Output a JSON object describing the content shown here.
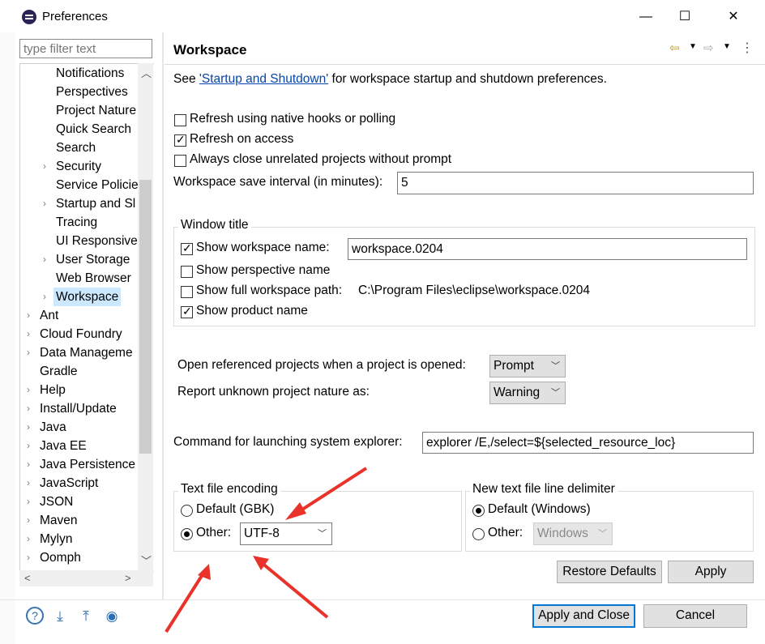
{
  "window": {
    "title": "Preferences",
    "minimize": "—",
    "maximize": "☐",
    "close": "✕"
  },
  "filter": {
    "placeholder": "type filter text"
  },
  "tree": {
    "items": [
      {
        "label": "Notifications",
        "expandable": false
      },
      {
        "label": "Perspectives",
        "expandable": false
      },
      {
        "label": "Project Nature",
        "expandable": false
      },
      {
        "label": "Quick Search",
        "expandable": false
      },
      {
        "label": "Search",
        "expandable": false
      },
      {
        "label": "Security",
        "expandable": true
      },
      {
        "label": "Service Policie",
        "expandable": false
      },
      {
        "label": "Startup and Sl",
        "expandable": true
      },
      {
        "label": "Tracing",
        "expandable": false
      },
      {
        "label": "UI Responsive",
        "expandable": false
      },
      {
        "label": "User Storage",
        "expandable": true
      },
      {
        "label": "Web Browser",
        "expandable": false
      },
      {
        "label": "Workspace",
        "expandable": true,
        "selected": true
      },
      {
        "label": "Ant",
        "expandable": true
      },
      {
        "label": "Cloud Foundry",
        "expandable": true
      },
      {
        "label": "Data Manageme",
        "expandable": true
      },
      {
        "label": "Gradle",
        "expandable": false
      },
      {
        "label": "Help",
        "expandable": true
      },
      {
        "label": "Install/Update",
        "expandable": true
      },
      {
        "label": "Java",
        "expandable": true
      },
      {
        "label": "Java EE",
        "expandable": true
      },
      {
        "label": "Java Persistence",
        "expandable": true
      },
      {
        "label": "JavaScript",
        "expandable": true
      },
      {
        "label": "JSON",
        "expandable": true
      },
      {
        "label": "Maven",
        "expandable": true
      },
      {
        "label": "Mylyn",
        "expandable": true
      },
      {
        "label": "Oomph",
        "expandable": true
      }
    ]
  },
  "page": {
    "title": "Workspace",
    "intro_prefix": "See ",
    "intro_link": "'Startup and Shutdown'",
    "intro_suffix": " for workspace startup and shutdown preferences.",
    "refresh_native": "Refresh using native hooks or polling",
    "refresh_access": "Refresh on access",
    "always_close": "Always close unrelated projects without prompt",
    "save_interval_label": "Workspace save interval (in minutes):",
    "save_interval_value": "5",
    "window_title_group": "Window title",
    "show_ws_name": "Show workspace name:",
    "ws_name_value": "workspace.0204",
    "show_perspective": "Show perspective name",
    "show_full_path": "Show full workspace path:",
    "full_path_value": "C:\\Program Files\\eclipse\\workspace.0204",
    "show_product": "Show product name",
    "open_ref_label": "Open referenced projects when a project is opened:",
    "open_ref_value": "Prompt",
    "unknown_nature_label": "Report unknown project nature as:",
    "unknown_nature_value": "Warning",
    "cmd_label": "Command for launching system explorer:",
    "cmd_value": "explorer /E,/select=${selected_resource_loc}",
    "encoding_group": "Text file encoding",
    "enc_default": "Default (GBK)",
    "enc_other": "Other:",
    "enc_other_value": "UTF-8",
    "delim_group": "New text file line delimiter",
    "delim_default": "Default (Windows)",
    "delim_other": "Other:",
    "delim_other_value": "Windows",
    "restore_defaults": "Restore Defaults",
    "apply": "Apply"
  },
  "footer": {
    "apply_close": "Apply and Close",
    "cancel": "Cancel"
  },
  "colors": {
    "selection": "#cce8ff",
    "default_button_border": "#0078d7",
    "annotation_arrow": "#e8322a"
  }
}
